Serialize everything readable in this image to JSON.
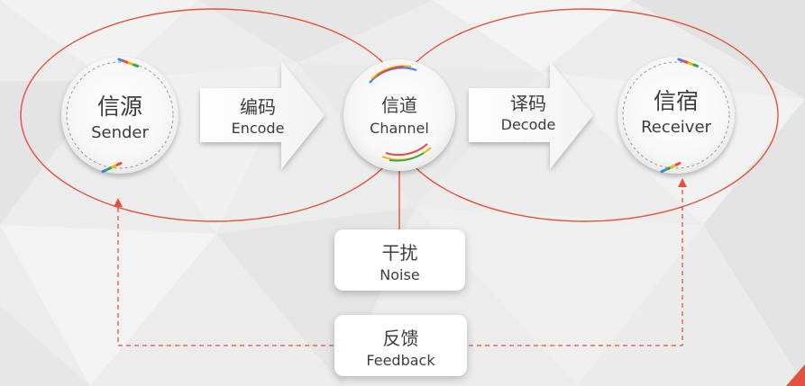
{
  "colors": {
    "circle_line": "#e3523f",
    "feedback_line": "#e3523f",
    "brand_blue": "#4a7ee8",
    "brand_red": "#e74c3c",
    "brand_yellow": "#f4b400",
    "brand_green": "#2ea84d",
    "text": "#3d3d3d"
  },
  "nodes": {
    "sender": {
      "zh": "信源",
      "en": "Sender"
    },
    "channel": {
      "zh": "信道",
      "en": "Channel"
    },
    "receiver": {
      "zh": "信宿",
      "en": "Receiver"
    }
  },
  "arrows": {
    "encode": {
      "zh": "编码",
      "en": "Encode"
    },
    "decode": {
      "zh": "译码",
      "en": "Decode"
    }
  },
  "boxes": {
    "noise": {
      "zh": "干扰",
      "en": "Noise"
    },
    "feedback": {
      "zh": "反馈",
      "en": "Feedback"
    }
  }
}
